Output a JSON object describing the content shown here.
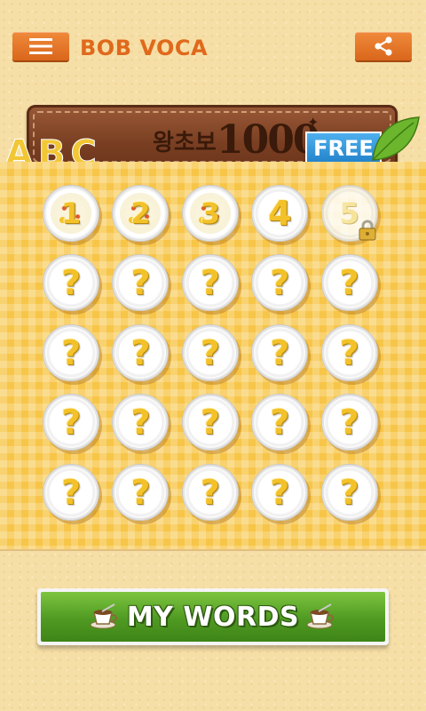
{
  "header": {
    "menu_icon": "hamburger-menu-icon",
    "title": "BOB VOCA",
    "share_icon": "share-icon"
  },
  "banner": {
    "title_kr": "왕초보",
    "number": "1000",
    "badge": "FREE",
    "decor_letters": "ABC"
  },
  "levels": [
    {
      "label": "1",
      "state": "cleared"
    },
    {
      "label": "2",
      "state": "cleared"
    },
    {
      "label": "3",
      "state": "cleared"
    },
    {
      "label": "4",
      "state": "open"
    },
    {
      "label": "5",
      "state": "locked"
    },
    {
      "label": "?",
      "state": "hidden"
    },
    {
      "label": "?",
      "state": "hidden"
    },
    {
      "label": "?",
      "state": "hidden"
    },
    {
      "label": "?",
      "state": "hidden"
    },
    {
      "label": "?",
      "state": "hidden"
    },
    {
      "label": "?",
      "state": "hidden"
    },
    {
      "label": "?",
      "state": "hidden"
    },
    {
      "label": "?",
      "state": "hidden"
    },
    {
      "label": "?",
      "state": "hidden"
    },
    {
      "label": "?",
      "state": "hidden"
    },
    {
      "label": "?",
      "state": "hidden"
    },
    {
      "label": "?",
      "state": "hidden"
    },
    {
      "label": "?",
      "state": "hidden"
    },
    {
      "label": "?",
      "state": "hidden"
    },
    {
      "label": "?",
      "state": "hidden"
    },
    {
      "label": "?",
      "state": "hidden"
    },
    {
      "label": "?",
      "state": "hidden"
    },
    {
      "label": "?",
      "state": "hidden"
    },
    {
      "label": "?",
      "state": "hidden"
    },
    {
      "label": "?",
      "state": "hidden"
    }
  ],
  "footer": {
    "my_words_label": "MY WORDS",
    "cup_icon": "coffee-cup-icon"
  },
  "colors": {
    "accent_orange": "#e0691c",
    "board_yellow": "#f7c548",
    "button_green": "#4f9a22",
    "badge_blue": "#1f7fc8"
  }
}
